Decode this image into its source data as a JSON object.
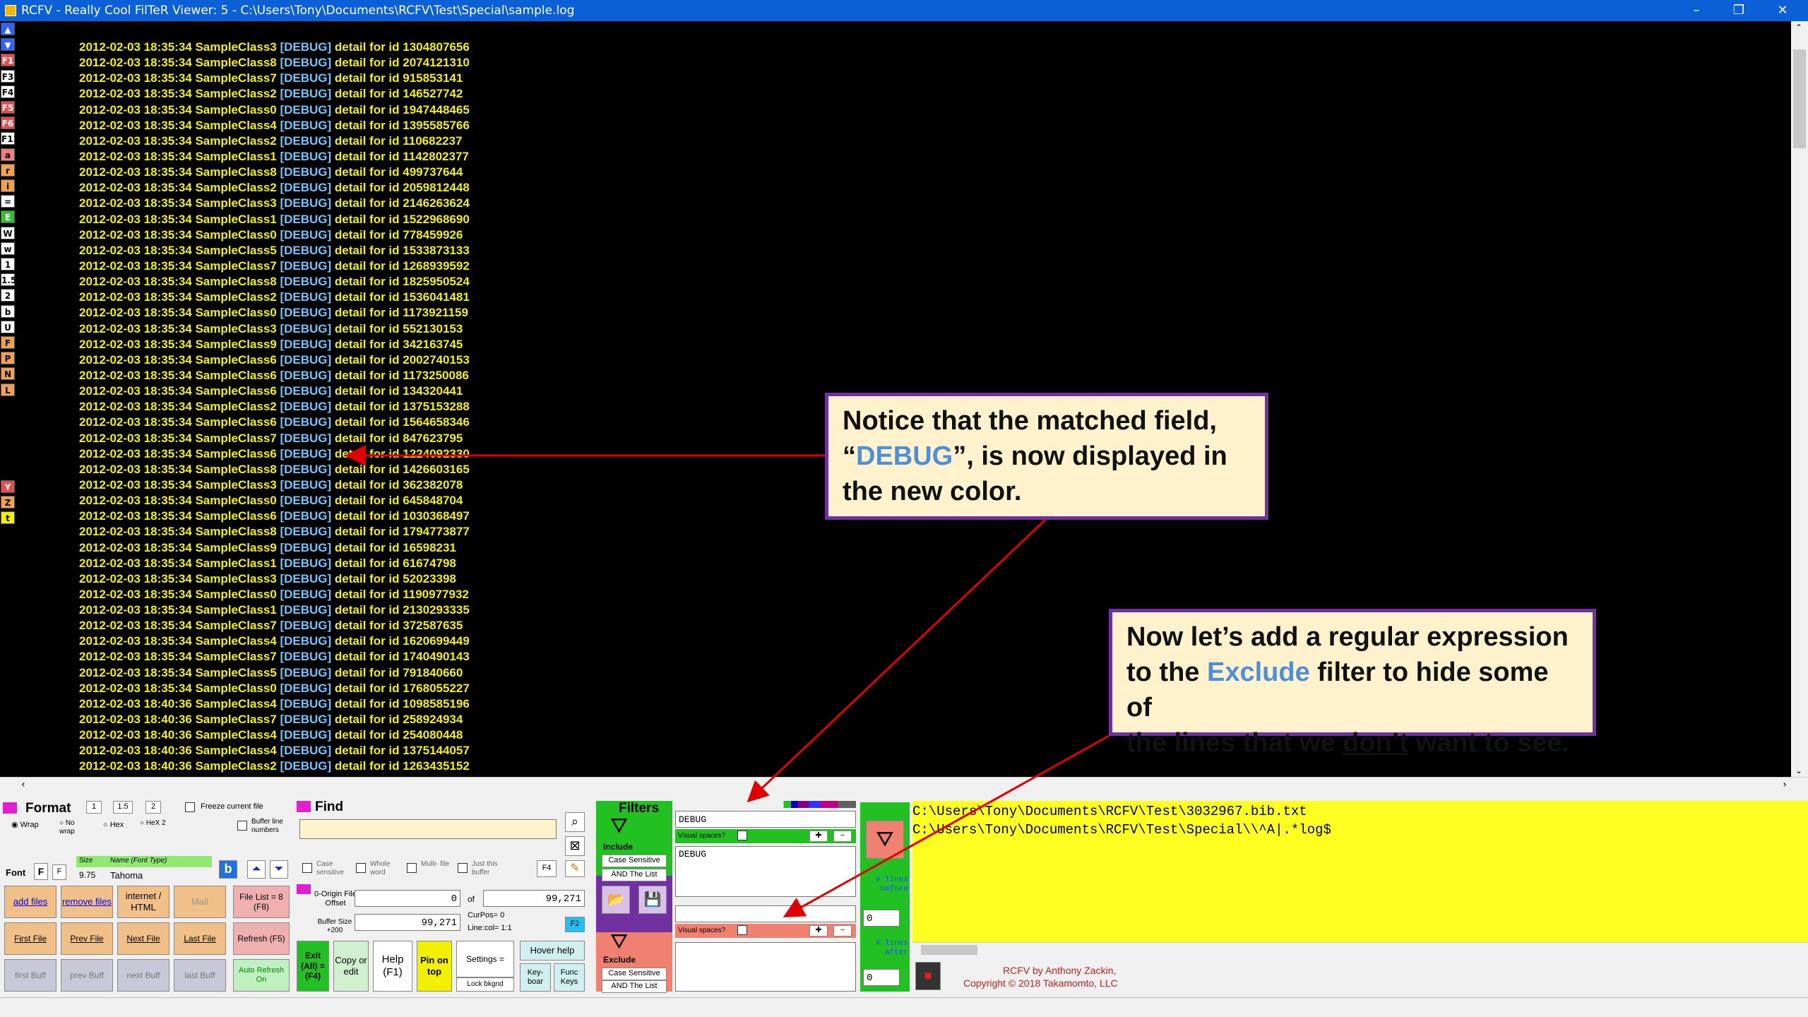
{
  "window": {
    "title": "RCFV - Really Cool FilTeR Viewer: 5 - C:\\Users\\Tony\\Documents\\RCFV\\Test\\Special\\sample.log",
    "min": "–",
    "restore": "❐",
    "close": "✕"
  },
  "sidebar": {
    "keys": [
      {
        "t": "▲",
        "bg": "#3060ff",
        "c": "#fff"
      },
      {
        "t": "▼",
        "bg": "#3060ff",
        "c": "#fff"
      },
      {
        "t": "F1",
        "bg": "#e05050",
        "c": "#fff"
      },
      {
        "t": "F3",
        "bg": "#fff",
        "c": "#000"
      },
      {
        "t": "F4",
        "bg": "#fff",
        "c": "#000"
      },
      {
        "t": "F5",
        "bg": "#e05050",
        "c": "#fff"
      },
      {
        "t": "F6",
        "bg": "#e05050",
        "c": "#fff"
      },
      {
        "t": "F11",
        "bg": "#fff",
        "c": "#000"
      },
      {
        "t": "a",
        "bg": "#f08080",
        "c": "#000"
      },
      {
        "t": "r",
        "bg": "#f0a050",
        "c": "#000"
      },
      {
        "t": "i",
        "bg": "#f0a050",
        "c": "#000"
      },
      {
        "t": "=",
        "bg": "#fff",
        "c": "#000"
      },
      {
        "t": "E",
        "bg": "#30c030",
        "c": "#fff"
      },
      {
        "t": "W",
        "bg": "#fff",
        "c": "#000"
      },
      {
        "t": "w",
        "bg": "#fff",
        "c": "#000"
      },
      {
        "t": "1",
        "bg": "#fff",
        "c": "#000"
      },
      {
        "t": "1.5",
        "bg": "#fff",
        "c": "#000"
      },
      {
        "t": "2",
        "bg": "#fff",
        "c": "#000"
      },
      {
        "t": "b",
        "bg": "#fff",
        "c": "#000"
      },
      {
        "t": "U",
        "bg": "#fff",
        "c": "#000"
      },
      {
        "t": "F",
        "bg": "#f0a050",
        "c": "#000"
      },
      {
        "t": "P",
        "bg": "#f0a050",
        "c": "#000"
      },
      {
        "t": "N",
        "bg": "#f0a050",
        "c": "#000"
      },
      {
        "t": "L",
        "bg": "#f0a050",
        "c": "#000"
      }
    ],
    "lower": [
      {
        "t": "Y",
        "bg": "#e05050",
        "c": "#fff"
      },
      {
        "t": "Z",
        "bg": "#f0a050",
        "c": "#000"
      },
      {
        "t": "t",
        "bg": "#f0f000",
        "c": "#000"
      }
    ]
  },
  "log": {
    "tag": "[DEBUG]",
    "lines": [
      [
        "2012-02-03 18:35:34 SampleClass3",
        "detail for id 1304807656"
      ],
      [
        "2012-02-03 18:35:34 SampleClass8",
        "detail for id 2074121310"
      ],
      [
        "2012-02-03 18:35:34 SampleClass7",
        "detail for id 915853141"
      ],
      [
        "2012-02-03 18:35:34 SampleClass2",
        "detail for id 146527742"
      ],
      [
        "2012-02-03 18:35:34 SampleClass0",
        "detail for id 1947448465"
      ],
      [
        "2012-02-03 18:35:34 SampleClass4",
        "detail for id 1395585766"
      ],
      [
        "2012-02-03 18:35:34 SampleClass2",
        "detail for id 110682237"
      ],
      [
        "2012-02-03 18:35:34 SampleClass1",
        "detail for id 1142802377"
      ],
      [
        "2012-02-03 18:35:34 SampleClass8",
        "detail for id 499737644"
      ],
      [
        "2012-02-03 18:35:34 SampleClass2",
        "detail for id 2059812448"
      ],
      [
        "2012-02-03 18:35:34 SampleClass3",
        "detail for id 2146263624"
      ],
      [
        "2012-02-03 18:35:34 SampleClass1",
        "detail for id 1522968690"
      ],
      [
        "2012-02-03 18:35:34 SampleClass0",
        "detail for id 778459926"
      ],
      [
        "2012-02-03 18:35:34 SampleClass5",
        "detail for id 1533873133"
      ],
      [
        "2012-02-03 18:35:34 SampleClass7",
        "detail for id 1268939592"
      ],
      [
        "2012-02-03 18:35:34 SampleClass8",
        "detail for id 1825950524"
      ],
      [
        "2012-02-03 18:35:34 SampleClass2",
        "detail for id 1536041481"
      ],
      [
        "2012-02-03 18:35:34 SampleClass0",
        "detail for id 1173921159"
      ],
      [
        "2012-02-03 18:35:34 SampleClass3",
        "detail for id 552130153"
      ],
      [
        "2012-02-03 18:35:34 SampleClass9",
        "detail for id 342163745"
      ],
      [
        "2012-02-03 18:35:34 SampleClass6",
        "detail for id 2002740153"
      ],
      [
        "2012-02-03 18:35:34 SampleClass6",
        "detail for id 1173250086"
      ],
      [
        "2012-02-03 18:35:34 SampleClass6",
        "detail for id 134320441"
      ],
      [
        "2012-02-03 18:35:34 SampleClass2",
        "detail for id 1375153288"
      ],
      [
        "2012-02-03 18:35:34 SampleClass6",
        "detail for id 1564658346"
      ],
      [
        "2012-02-03 18:35:34 SampleClass7",
        "detail for id 847623795"
      ],
      [
        "2012-02-03 18:35:34 SampleClass6",
        "detail for id 1224092330"
      ],
      [
        "2012-02-03 18:35:34 SampleClass8",
        "detail for id 1426603165"
      ],
      [
        "2012-02-03 18:35:34 SampleClass3",
        "detail for id 362382078"
      ],
      [
        "2012-02-03 18:35:34 SampleClass0",
        "detail for id 645848704"
      ],
      [
        "2012-02-03 18:35:34 SampleClass6",
        "detail for id 1030368497"
      ],
      [
        "2012-02-03 18:35:34 SampleClass8",
        "detail for id 1794773877"
      ],
      [
        "2012-02-03 18:35:34 SampleClass9",
        "detail for id 16598231"
      ],
      [
        "2012-02-03 18:35:34 SampleClass1",
        "detail for id 61674798"
      ],
      [
        "2012-02-03 18:35:34 SampleClass3",
        "detail for id 52023398"
      ],
      [
        "2012-02-03 18:35:34 SampleClass0",
        "detail for id 1190977932"
      ],
      [
        "2012-02-03 18:35:34 SampleClass1",
        "detail for id 2130293335"
      ],
      [
        "2012-02-03 18:35:34 SampleClass7",
        "detail for id 372587635"
      ],
      [
        "2012-02-03 18:35:34 SampleClass4",
        "detail for id 1620699449"
      ],
      [
        "2012-02-03 18:35:34 SampleClass7",
        "detail for id 1740490143"
      ],
      [
        "2012-02-03 18:35:34 SampleClass5",
        "detail for id 791840660"
      ],
      [
        "2012-02-03 18:35:34 SampleClass0",
        "detail for id 1768055227"
      ],
      [
        "2012-02-03 18:40:36 SampleClass4",
        "detail for id 1098585196"
      ],
      [
        "2012-02-03 18:40:36 SampleClass7",
        "detail for id 258924934"
      ],
      [
        "2012-02-03 18:40:36 SampleClass4",
        "detail for id 254080448"
      ],
      [
        "2012-02-03 18:40:36 SampleClass4",
        "detail for id 1375144057"
      ],
      [
        "2012-02-03 18:40:36 SampleClass2",
        "detail for id 1263435152"
      ]
    ]
  },
  "format": {
    "title": "Format",
    "sizes": [
      "1",
      "1.5",
      "2"
    ],
    "freeze": "Freeze current file",
    "wrap": "Wrap",
    "nowrap": "No wrap",
    "hex": "Hex",
    "hex2": "HeX 2",
    "buffer_line_numbers": "Buffer line numbers",
    "font_label": "Font",
    "font_b1": "F",
    "font_b2": "F",
    "size_label": "Size",
    "size": "9.75",
    "name_label": "Name (Font Type)",
    "font_name": "Tahoma",
    "bold": "b"
  },
  "buttons": {
    "add_files": "add files",
    "remove_files": "remove files",
    "internet": "internet / HTML",
    "mail": "Mail",
    "file_list": "File List = 8 (F8)",
    "first_file": "First File",
    "prev_file": "Prev File",
    "next_file": "Next File",
    "last_file": "Last File",
    "refresh": "Refresh (F5)",
    "first_buff": "first Buff",
    "prev_buff": "prev Buff",
    "next_buff": "next Buff",
    "last_buff": "last Buff",
    "auto_refresh": "Auto Refresh On",
    "exit": "Exit (All) = (F4)",
    "copy_edit": "Copy or edit",
    "help": "Help (F1)",
    "pin": "Pin on top",
    "settings": "Settings =",
    "lock": "Lock bkgnd",
    "hover_help": "Hover help",
    "keyboard": "Key- boar",
    "func_keys": "Func Keys"
  },
  "find": {
    "title": "Find",
    "value": "",
    "case": "Case sensitive",
    "whole": "Whole word",
    "multi": "Multi- file",
    "just": "Just this buffer",
    "f4": "F4",
    "origin": "0-Origin File Offset",
    "offset": "0",
    "of": "of",
    "total": "99,271",
    "bufsize_label": "Buffer Size +200",
    "bufsize": "99,271",
    "curpos": "CurPos= 0",
    "linecol": "Line:col= 1:1",
    "f2": "F2"
  },
  "filters": {
    "title": "Filters",
    "include_label": "Include",
    "case_btn": "Case Sensitive",
    "and_list": "AND The List",
    "include_input": "DEBUG",
    "visual_spaces": "Visual spaces?",
    "include_list": "DEBUG",
    "exclude_label": "Exclude",
    "exclude_input": "",
    "exclude_list": "",
    "case_btn2": "Case Sensitive",
    "and_list2": "AND The List"
  },
  "lines": {
    "before_label": "# lines before",
    "before": "0",
    "after_label": "# lines after",
    "after": "0"
  },
  "files": {
    "lines": [
      "C:\\Users\\Tony\\Documents\\RCFV\\Test\\3032967.bib.txt",
      "C:\\Users\\Tony\\Documents\\RCFV\\Test\\Special\\\\^A|.*log$"
    ]
  },
  "credits": {
    "line1": "RCFV by Anthony Zackin,",
    "line2": "Copyright © 2018 Takamomto, LLC"
  },
  "callouts": {
    "c1": {
      "pre": "Notice that the matched field,",
      "q_open": "“",
      "hl": "DEBUG",
      "q_close": "”, is now displayed in",
      "post": "the new color."
    },
    "c2": {
      "l1": "Now let’s add a regular expression",
      "l2a": "to the ",
      "hl": "Exclude",
      "l2b": " filter to hide some of",
      "l3a": "the lines that we ",
      "u": "don’t",
      "l3b": " want to see."
    }
  },
  "colors": {
    "log_text": "#f2f200",
    "tag": "#6ec6ff",
    "accent": "#7030a0",
    "callout_bg": "#fff2cc",
    "arrow": "#e00000",
    "filter_green": "#22c022",
    "exclude_red": "#f08070",
    "file_bg": "#ffff22"
  }
}
